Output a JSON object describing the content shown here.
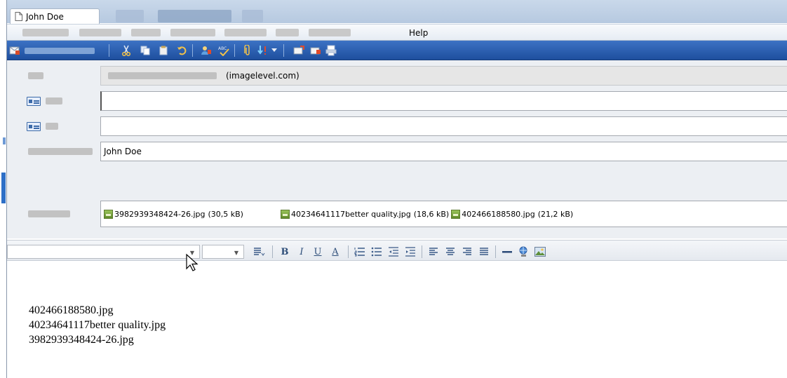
{
  "window": {
    "title": "John Doe"
  },
  "menu": {
    "help_label": "Help"
  },
  "toolbar": {
    "items": [
      "scissors-icon",
      "copy-icon",
      "paste-icon",
      "undo-icon",
      "address-book-icon",
      "spellcheck-icon",
      "attach-icon",
      "priority-icon",
      "dropdown-icon",
      "receive-icon",
      "send-icon",
      "print-icon"
    ]
  },
  "header": {
    "from_domain": "(imagelevel.com)",
    "to_value": "",
    "cc_value": "",
    "subject_value": "John Doe",
    "attachments": [
      {
        "name": "3982939348424-26.jpg",
        "size": "(30,5 kB)"
      },
      {
        "name": "40234641117better quality.jpg",
        "size": "(18,6 kB)"
      },
      {
        "name": "402466188580.jpg",
        "size": "(21,2 kB)"
      }
    ]
  },
  "format": {
    "bold": "B",
    "italic": "I",
    "underline": "U",
    "font_color": "A"
  },
  "body": {
    "lines": [
      "402466188580.jpg",
      "40234641117better quality.jpg",
      "3982939348424-26.jpg"
    ]
  },
  "colors": {
    "toolbar_blue": "#1e4f9e",
    "jpg_icon_green": "#5f8a2a"
  }
}
